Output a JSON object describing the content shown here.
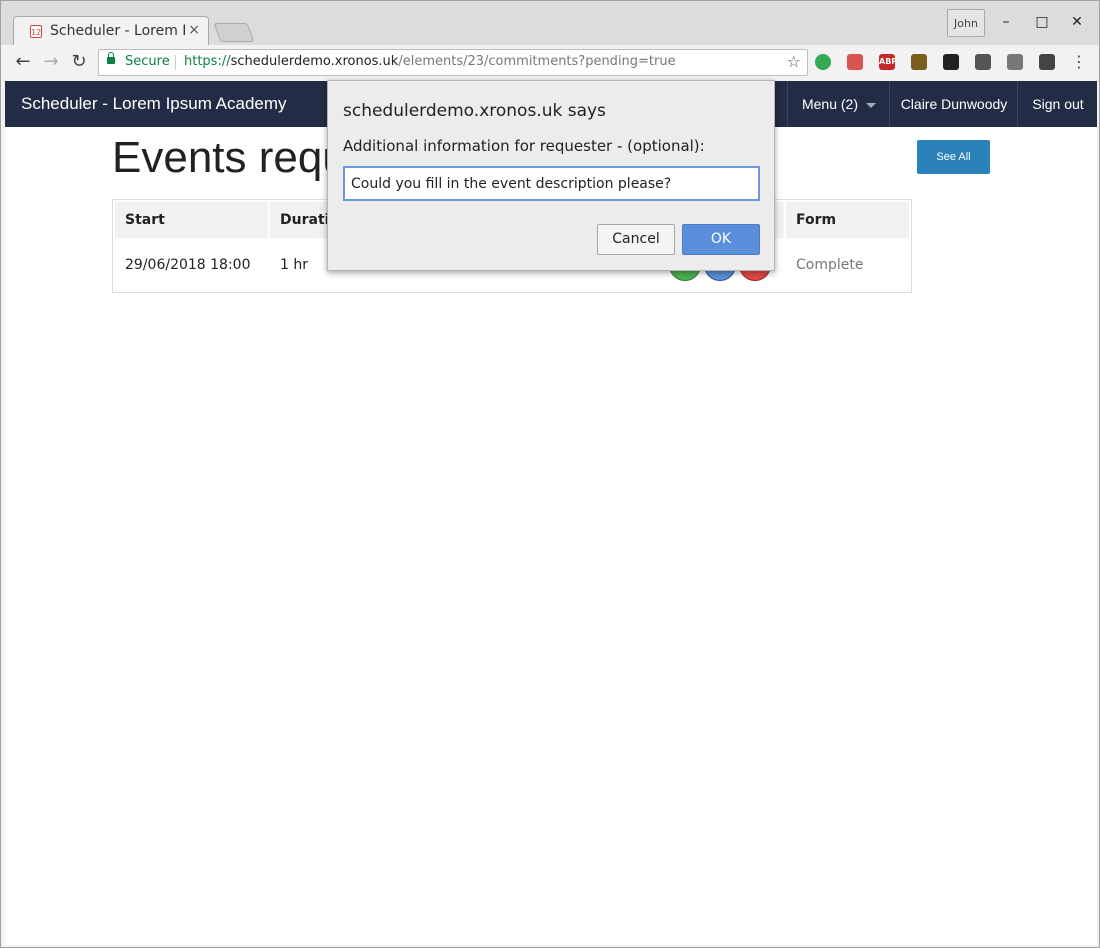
{
  "browser": {
    "tab_title": "Scheduler - Lorem Ipsum Academy",
    "tab_favicon": "12",
    "tab_close": "×",
    "profile_name": "John",
    "window_controls": {
      "minimize": "–",
      "maximize": "□",
      "close": "✕"
    },
    "nav": {
      "back": "←",
      "forward": "→",
      "reload": "↻"
    },
    "secure_label": "Secure",
    "url": {
      "scheme": "https://",
      "host": "schedulerdemo.xronos.uk",
      "path": "/elements/23/commitments?pending=true"
    },
    "star": "☆",
    "extensions": [
      {
        "name": "green-bubble-extension-icon",
        "color": "#34a853",
        "label": ""
      },
      {
        "name": "red-puzzle-extension-icon",
        "color": "#d9534f",
        "label": ""
      },
      {
        "name": "adblock-plus-icon",
        "color": "#c62828",
        "label": "ABP"
      },
      {
        "name": "house-extension-icon",
        "color": "#7a5c1e",
        "label": ""
      },
      {
        "name": "pawprint-extension-icon",
        "color": "#222222",
        "label": ""
      },
      {
        "name": "keep-extension-icon",
        "color": "#555555",
        "label": ""
      },
      {
        "name": "mail-extension-icon",
        "color": "#777777",
        "label": ""
      },
      {
        "name": "screenshot-extension-icon",
        "color": "#444444",
        "label": ""
      }
    ],
    "menu_icon": "⋮"
  },
  "navbar": {
    "brand": "Scheduler - Lorem Ipsum Academy",
    "menu_label": "Menu (2)",
    "user_name": "Claire Dunwoody",
    "sign_out": "Sign out"
  },
  "page": {
    "heading_visible": "Events requ",
    "see_all": "See All",
    "table": {
      "headers": [
        "Start",
        "Durati",
        "",
        "",
        "Form"
      ],
      "rows": [
        {
          "start": "29/06/2018 18:00",
          "duration": "1 hr",
          "form": "Complete"
        }
      ]
    }
  },
  "dialog": {
    "title": "schedulerdemo.xronos.uk says",
    "message": "Additional information for requester - (optional):",
    "input_value": "Could you fill in the event description please?",
    "cancel": "Cancel",
    "ok": "OK"
  },
  "colors": {
    "navbar_bg": "#222c44",
    "see_all_bg": "#2a82b8",
    "ok_button_bg": "#5b8fdc",
    "secure_green": "#0b8043"
  }
}
